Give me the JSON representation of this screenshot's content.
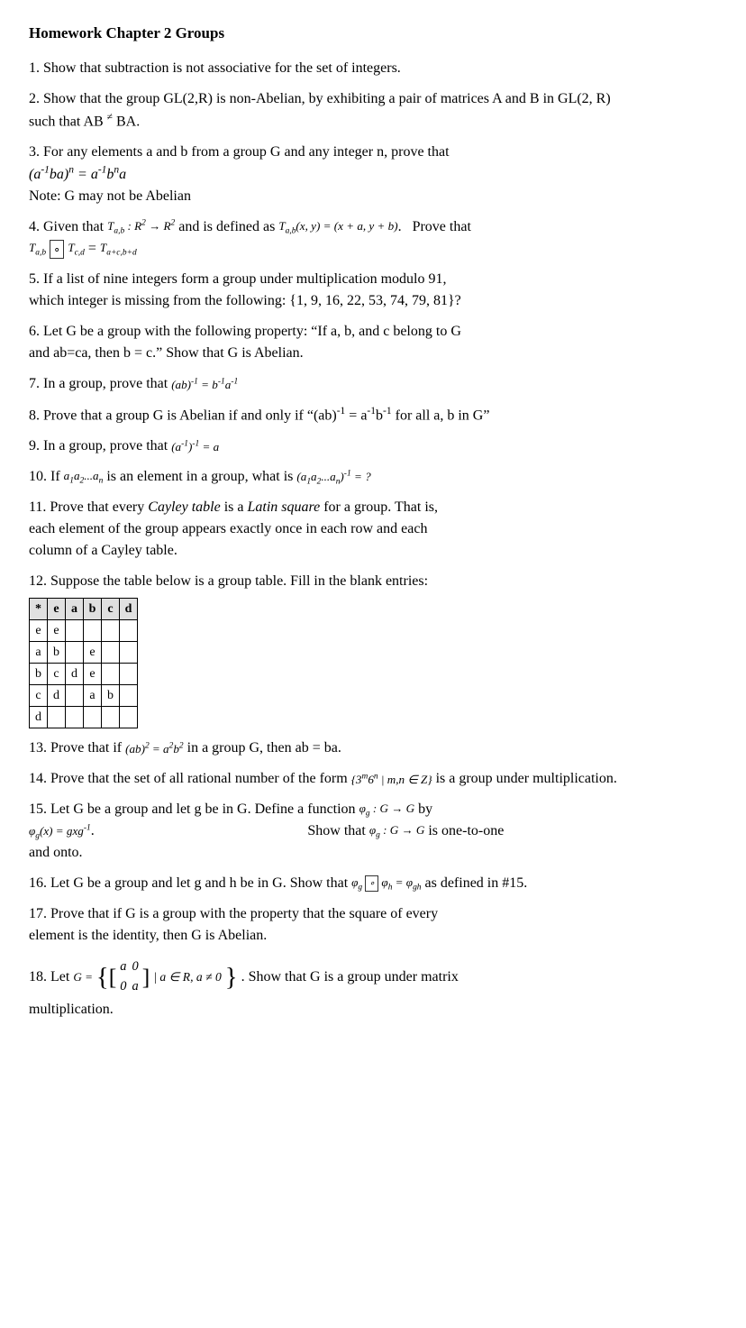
{
  "title": "Homework Chapter 2 Groups",
  "problems": [
    {
      "id": "p1",
      "text": "1. Show that subtraction is not associative for the set of integers."
    },
    {
      "id": "p2",
      "lines": [
        "2. Show that the group GL(2,R) is non-Abelian, by exhibiting a pair of matrices A and B in GL(2, R)",
        "such that AB ≠ BA."
      ]
    },
    {
      "id": "p3",
      "text": "3. For any elements a and b from a group G and any integer n, prove that"
    },
    {
      "id": "p3formula",
      "text": "(a⁻¹ba)ⁿ = a⁻¹bⁿa"
    },
    {
      "id": "p3note",
      "text": "Note: G may not be Abelian"
    },
    {
      "id": "p4",
      "prefix": "4. Given that",
      "formula1": "T_{a,b} : R² → R²",
      "mid": "and is defined as",
      "formula2": "T_{a,b}(x, y) = (x + a, y + b).",
      "suffix": "Prove that",
      "formula3": "T_{a,b} ∘ T_{c,d} = T_{a+c,b+d}"
    },
    {
      "id": "p5",
      "lines": [
        "5. If a list of nine integers form a group under multiplication modulo 91,",
        "which integer is missing from the following: {1, 9, 16, 22, 53, 74, 79, 81}?"
      ]
    },
    {
      "id": "p6",
      "lines": [
        "6. Let G be a group with the following property: \"If a, b, and c belong to G",
        "and ab=ca, then b = c.\" Show that G is Abelian."
      ]
    },
    {
      "id": "p7",
      "prefix": "7. In a group, prove that",
      "formula": "(ab)⁻¹ = b⁻¹a⁻¹"
    },
    {
      "id": "p8",
      "prefix": "8. Prove that a group G is Abelian if and only if \"(ab)⁻¹ = a⁻¹b⁻¹",
      "suffix": "for all a, b in G\""
    },
    {
      "id": "p9",
      "prefix": "9. In a group, prove that",
      "formula": "(a⁻¹)⁻¹ = a"
    },
    {
      "id": "p10",
      "prefix": "10. If",
      "formula1": "a₁a₂...aₙ",
      "mid": "is an element in a group, what is",
      "formula2": "(a₁a₂...aₙ)⁻¹ = ?"
    },
    {
      "id": "p11",
      "lines": [
        "11. Prove that every Cayley table is a Latin square for a group. That is,",
        "each element of the group appears exactly once in each row and each",
        "column of a Cayley table."
      ]
    },
    {
      "id": "p12",
      "text": "12. Suppose the table below is a group table. Fill in the blank entries:"
    },
    {
      "id": "p13",
      "prefix": "13. Prove that if",
      "formula": "(ab)² = a²b²",
      "suffix": "in a group G, then ab = ba."
    },
    {
      "id": "p13spacer",
      "text": ""
    },
    {
      "id": "p14",
      "prefix": "14. Prove that the set of all rational number of the form",
      "formula": "{3ᵐ6ⁿ | m,n ∈ Z}",
      "suffix": "is a group under multiplication."
    },
    {
      "id": "p15",
      "prefix": "15. Let G be a group and let g be in G. Define a function",
      "formula1": "φ_g : G → G",
      "mid": "by",
      "formula2": "φ_g(x) = gxg⁻¹.",
      "suffix1": "Show that",
      "formula3": "φ_g : G → G",
      "suffix2": "is one-to-one and onto."
    },
    {
      "id": "p16",
      "prefix": "16. Let G be a group and let g and h be in G. Show that",
      "formula": "φ_g ∘ φ_h = φ_{gh}",
      "suffix": "as defined in #15."
    },
    {
      "id": "p17",
      "lines": [
        "17. Prove that if G is a group with the property that the square of every",
        "element is the identity, then G is Abelian."
      ]
    },
    {
      "id": "p18",
      "prefix": "18. Let",
      "suffix": ". Show that G is a group under matrix multiplication."
    }
  ],
  "cayley": {
    "headers": [
      "*",
      "e",
      "a",
      "b",
      "c",
      "d"
    ],
    "rows": [
      [
        "e",
        "e",
        "",
        "",
        "",
        ""
      ],
      [
        "a",
        "b",
        "",
        "e",
        "",
        ""
      ],
      [
        "b",
        "c",
        "d",
        "e",
        "",
        ""
      ],
      [
        "c",
        "d",
        "",
        "a",
        "b",
        ""
      ],
      [
        "d",
        "",
        "",
        "",
        "",
        ""
      ]
    ]
  }
}
